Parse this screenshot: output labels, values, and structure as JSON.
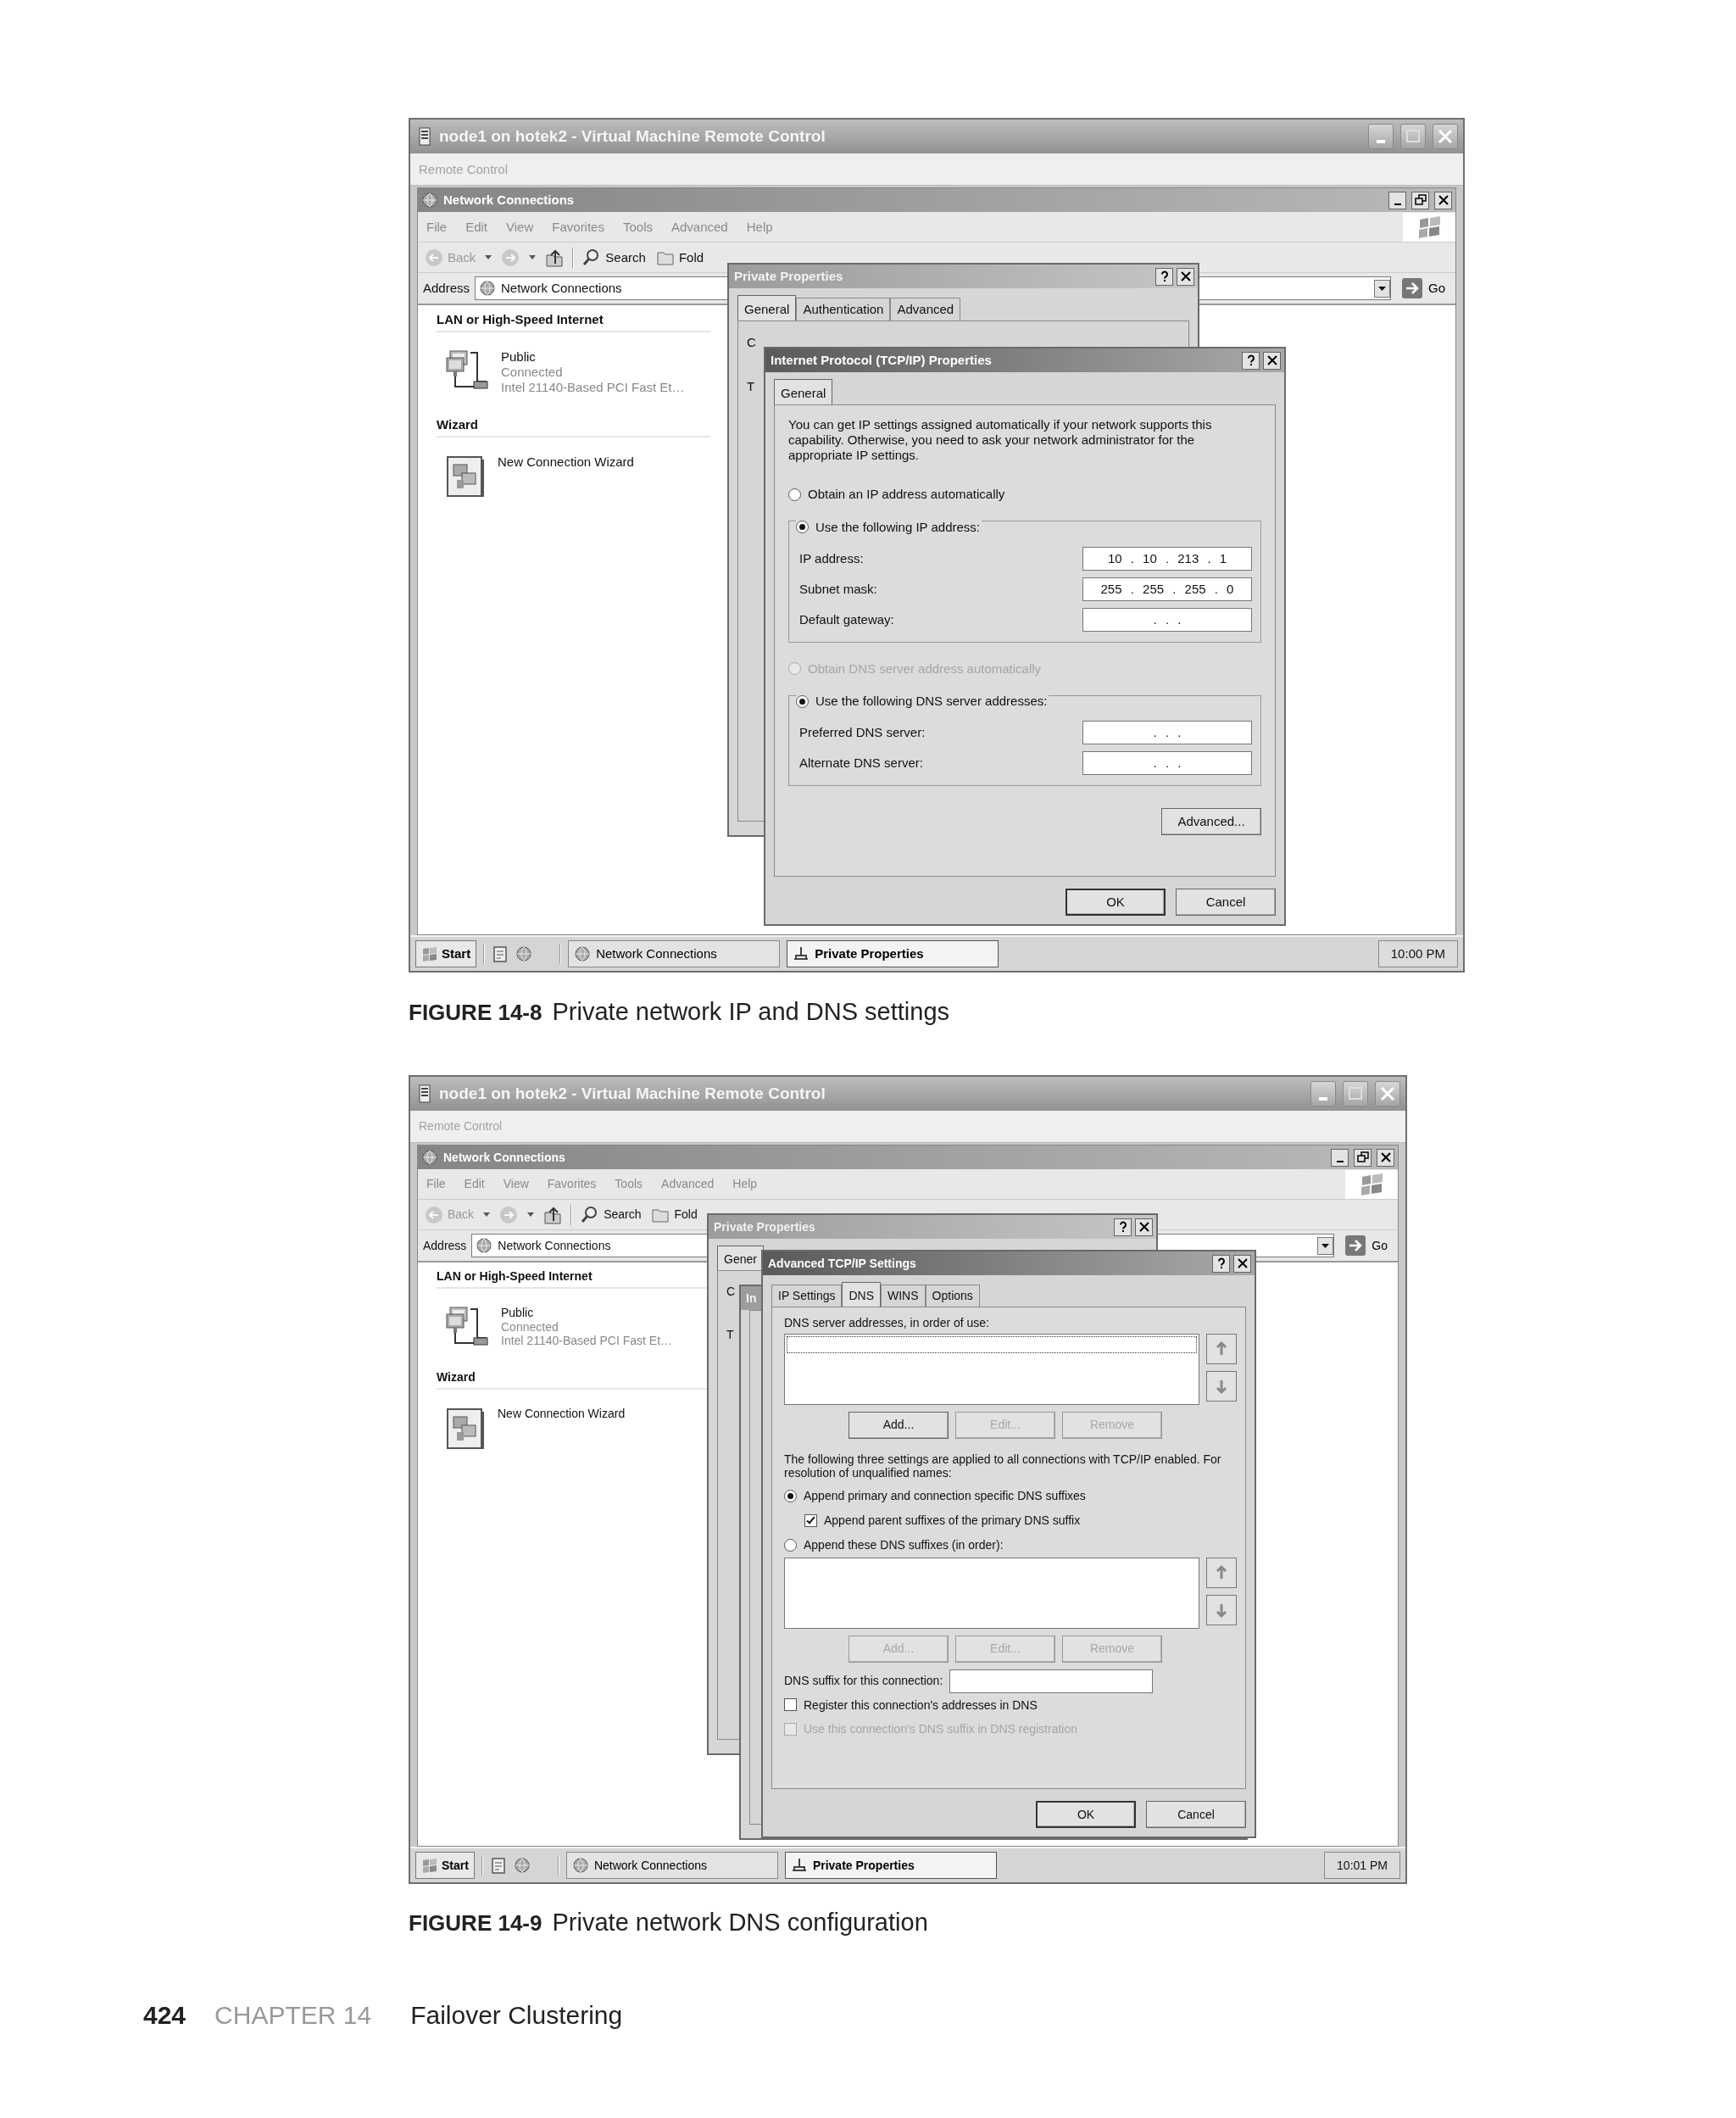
{
  "figures": [
    {
      "vm_window": {
        "title": "node1 on hotek2 - Virtual Machine Remote Control",
        "menu": [
          "Remote Control"
        ]
      },
      "explorer": {
        "title": "Network Connections",
        "menu": [
          "File",
          "Edit",
          "View",
          "Favorites",
          "Tools",
          "Advanced",
          "Help"
        ],
        "toolbar": [
          {
            "kind": "back",
            "label": "Back",
            "disabled": true
          },
          {
            "kind": "forward",
            "disabled": true
          },
          {
            "kind": "up",
            "disabled": false
          },
          {
            "kind": "search",
            "label": "Search",
            "disabled": false
          },
          {
            "kind": "folders",
            "label": "Fold",
            "disabled": false
          }
        ],
        "address_label": "Address",
        "address_value": "Network Connections",
        "go": "Go",
        "groups": [
          {
            "heading": "LAN or High-Speed Internet",
            "items": [
              {
                "kind": "connection",
                "name": "Public",
                "status": "Connected",
                "device": "Intel 21140-Based PCI Fast Et…"
              }
            ]
          },
          {
            "heading": "Wizard",
            "items": [
              {
                "kind": "wizard",
                "name": "New Connection Wizard"
              }
            ]
          }
        ]
      },
      "back_dialog": {
        "title": "Private Properties",
        "tabs": [
          {
            "label": "General",
            "selected": true
          },
          {
            "label": "Authentication",
            "selected": false
          },
          {
            "label": "Advanced",
            "selected": false
          }
        ],
        "fragments": [
          "C",
          "T"
        ]
      },
      "dialog": {
        "kind": "tcpip",
        "title": "Internet Protocol (TCP/IP) Properties",
        "tabs": [
          {
            "label": "General",
            "selected": true
          }
        ],
        "intro": "You can get IP settings assigned automatically if your network supports this capability. Otherwise, you need to ask your network administrator for the appropriate IP settings.",
        "ip_mode": [
          {
            "label": "Obtain an IP address automatically",
            "selected": false,
            "disabled": false
          },
          {
            "label": "Use the following IP address:",
            "selected": true,
            "disabled": false
          }
        ],
        "ip_fields": [
          {
            "label": "IP address:",
            "value": "10 . 10 . 213 . 1"
          },
          {
            "label": "Subnet mask:",
            "value": "255 . 255 . 255 . 0"
          },
          {
            "label": "Default gateway:",
            "value": ". . ."
          }
        ],
        "dns_mode": [
          {
            "label": "Obtain DNS server address automatically",
            "selected": false,
            "disabled": true
          },
          {
            "label": "Use the following DNS server addresses:",
            "selected": true,
            "disabled": false
          }
        ],
        "dns_fields": [
          {
            "label": "Preferred DNS server:",
            "value": ". . ."
          },
          {
            "label": "Alternate DNS server:",
            "value": ". . ."
          }
        ],
        "advanced_button": "Advanced...",
        "footer_buttons": [
          "OK",
          "Cancel"
        ]
      },
      "taskbar": {
        "start": "Start",
        "tasks": [
          {
            "kind": "network",
            "label": "Network Connections",
            "selected": false
          },
          {
            "kind": "properties",
            "label": "Private Properties",
            "selected": true
          }
        ],
        "clock": "10:00 PM"
      },
      "caption": {
        "number": "FIGURE 14-8",
        "text": "Private network IP and DNS settings"
      }
    },
    {
      "vm_window": {
        "title": "node1 on hotek2 - Virtual Machine Remote Control",
        "menu": [
          "Remote Control"
        ]
      },
      "explorer": {
        "title": "Network Connections",
        "menu": [
          "File",
          "Edit",
          "View",
          "Favorites",
          "Tools",
          "Advanced",
          "Help"
        ],
        "toolbar": [
          {
            "kind": "back",
            "label": "Back",
            "disabled": true
          },
          {
            "kind": "forward",
            "disabled": true
          },
          {
            "kind": "up",
            "disabled": false
          },
          {
            "kind": "search",
            "label": "Search",
            "disabled": false
          },
          {
            "kind": "folders",
            "label": "Fold",
            "disabled": false
          }
        ],
        "address_label": "Address",
        "address_value": "Network Connections",
        "go": "Go",
        "groups": [
          {
            "heading": "LAN or High-Speed Internet",
            "items": [
              {
                "kind": "connection",
                "name": "Public",
                "status": "Connected",
                "device": "Intel 21140-Based PCI Fast Et…"
              }
            ]
          },
          {
            "heading": "Wizard",
            "items": [
              {
                "kind": "wizard",
                "name": "New Connection Wizard"
              }
            ]
          }
        ]
      },
      "back_dialog": {
        "title": "Private Properties",
        "tabs": [
          {
            "label": "Gener",
            "selected": true
          }
        ],
        "fragments": [
          "C",
          "T"
        ]
      },
      "middle_dialog": {
        "title": "In"
      },
      "dialog": {
        "kind": "advanced",
        "title": "Advanced TCP/IP Settings",
        "tabs": [
          {
            "label": "IP Settings",
            "selected": false
          },
          {
            "label": "DNS",
            "selected": true
          },
          {
            "label": "WINS",
            "selected": false
          },
          {
            "label": "Options",
            "selected": false
          }
        ],
        "server_list_label": "DNS server addresses, in order of use:",
        "server_buttons": [
          {
            "label": "Add...",
            "disabled": false
          },
          {
            "label": "Edit...",
            "disabled": true
          },
          {
            "label": "Remove",
            "disabled": true
          }
        ],
        "note": "The following three settings are applied to all connections with TCP/IP enabled. For resolution of unqualified names:",
        "options": [
          {
            "label": "Append primary and connection specific DNS suffixes",
            "selected": true,
            "children": [
              {
                "label": "Append parent suffixes of the primary DNS suffix",
                "checked": true
              }
            ]
          },
          {
            "label": "Append these DNS suffixes (in order):",
            "selected": false
          }
        ],
        "suffix_buttons": [
          {
            "label": "Add...",
            "disabled": true
          },
          {
            "label": "Edit...",
            "disabled": true
          },
          {
            "label": "Remove",
            "disabled": true
          }
        ],
        "suffix_field_label": "DNS suffix for this connection:",
        "checks": [
          {
            "label": "Register this connection's addresses in DNS",
            "checked": false,
            "disabled": false
          },
          {
            "label": "Use this connection's DNS suffix in DNS registration",
            "checked": false,
            "disabled": true
          }
        ],
        "footer_buttons": [
          "OK",
          "Cancel"
        ]
      },
      "taskbar": {
        "start": "Start",
        "tasks": [
          {
            "kind": "network",
            "label": "Network Connections",
            "selected": false
          },
          {
            "kind": "properties",
            "label": "Private Properties",
            "selected": true
          }
        ],
        "clock": "10:01 PM"
      },
      "caption": {
        "number": "FIGURE 14-9",
        "text": "Private network DNS configuration"
      }
    }
  ],
  "footer": {
    "page": "424",
    "chapter": "CHAPTER 14",
    "title": "Failover Clustering"
  }
}
